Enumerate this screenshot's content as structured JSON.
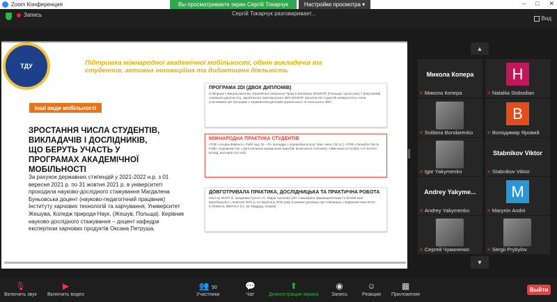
{
  "window": {
    "title": "Zoom Конференция"
  },
  "topbar": {
    "recording_label": "Запись",
    "viewing_banner": "Вы просматриваете экран Сергій Токарчук",
    "view_options": "Настройки просмотра ▾",
    "speaking_indicator": "Сергій Токарчук разговаривает...",
    "view_label": "Вид"
  },
  "slide": {
    "logo_text": "ТДУ",
    "headline": "Підтримка міжнародної академічної мобільності, обмін викладачів та студентів, активна інноваційна та дидактивна діяльність",
    "tag": "Інші види мобільності",
    "main_title": "Зростання числа студентів, викладачів і дослідників, що беруть участь у програмах академічної мобільності",
    "main_body": "За рахунок державних стипендій у 2021-2022 н.р. з 01 вересня 2021 р. по 31 жовтня 2021 р. в університеті проходила науково-дослідного стажування Магдалена Буньовська доцент (науково-педагогічний працівник) Інституту харчових технологій та харчування, Университет Жешува, Коледж природи Наук, (Жешув, Польща). Керівник науково-дослідного стажування – доцент кафедри експертизи харчових продуктів Оксана Петруша.",
    "cards": [
      {
        "title": "ПРОГРАМА 2DI (ДВОХ ДИПЛОМІВ)",
        "text": "Співпраця з Вищою Школою Управління Охороною Праці в Катовіцах (WSZOP) (Польща). Цього року 7 випускників отримали диплом ЄЦ, заробленого партнерського ЗВО WSZOP. Загалом 28 студентів університету стали учасниками цієї програми з отриманням дипломів українського та польського ЗВО."
      },
      {
        "title": "МІЖНАРОДНА ПРАКТИКА СТУДЕНТІВ",
        "text": "•ТОВ «Альфа-Файнесс» Рибії кнд, tto. «П» (каладри з переробки м'яса), Мінс-чина; (22 ос.); •ТОВ «Італьйба Пастa Рибії» (підприємство з виготовлення макаронних виробів, включаючи солозаїя), Німеччина (3 особи); •«Т-Хотел» ЕООД, Болгарія (10 осіб)."
      },
      {
        "title": "ДОВГОТРИВАЛА ПРАКТИКА, ДОСЛІДНИЦЬКА ТА ПРАКТИЧНА РОБОТА",
        "text": "Магістр ФНТП бі. академіки Гулого І.С. Марія Анпілова (ОП «Інжиніринг фармацевтичних та біохімічних виробництв») з вересня 2021 р. по вересень 2022 року в рамках договору про співпрацю з підприємством ЮНА CHEMICAL IBERICA S.L. (м. Мадрид, Іспанія)"
      }
    ]
  },
  "participants": [
    {
      "big": "Микола Копера",
      "label": "Микола Копера",
      "kind": "name"
    },
    {
      "big": "H",
      "label": "Nataliia Slobodian",
      "kind": "avatar",
      "color": "#c2185b"
    },
    {
      "big": "",
      "label": "Svitlana Bondarenko",
      "kind": "photo"
    },
    {
      "big": "В",
      "label": "Володимир Яровий",
      "kind": "avatar",
      "color": "#e24d1b"
    },
    {
      "big": "",
      "label": "Igor Yakymenko",
      "kind": "photo"
    },
    {
      "big": "Stabnikov Viktor",
      "label": "Stabnikov Viktor",
      "kind": "name"
    },
    {
      "big": "Andrey Yakyme...",
      "label": "Andrey Yakymenko",
      "kind": "name"
    },
    {
      "big": "M",
      "label": "Marynin Andrii",
      "kind": "avatar",
      "color": "#2b96d6"
    },
    {
      "big": "",
      "label": "Сергей Чумаченко",
      "kind": "photo"
    },
    {
      "big": "",
      "label": "Sergii Prybylov",
      "kind": "photo"
    }
  ],
  "toolbar": {
    "mic": "Включить звук",
    "video": "Включить видео",
    "participants": "Участники",
    "participants_count": "50",
    "chat": "Чат",
    "share": "Демонстрация экрана",
    "record": "Запись",
    "reactions": "Реакции",
    "apps": "Приложения",
    "leave": "Выйти"
  },
  "colors": {
    "accent_green": "#2fb344",
    "leave_red": "#e34043",
    "slide_orange": "#e8741a",
    "slide_gold": "#e6b100"
  }
}
